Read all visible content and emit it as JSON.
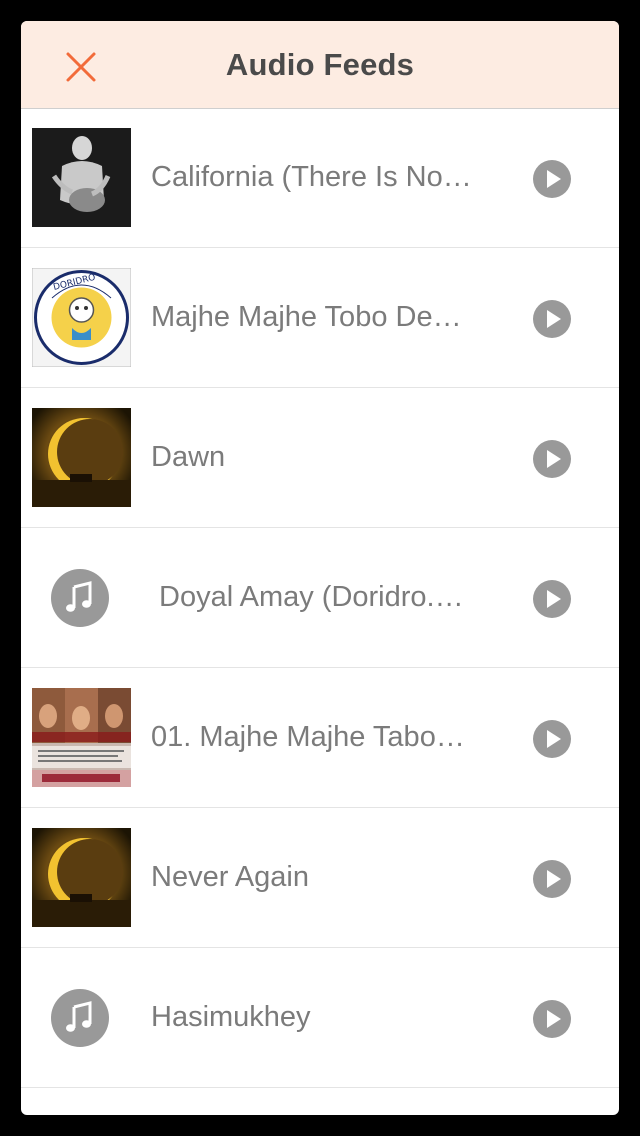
{
  "header": {
    "title": "Audio Feeds",
    "close_icon": "close-icon"
  },
  "colors": {
    "header_bg": "#fdece2",
    "close_accent": "#f26b3a",
    "text_gray": "#7b7b7b",
    "icon_gray": "#999999",
    "title_text": "#4a4a4a"
  },
  "feeds": [
    {
      "title": "California (There Is No…",
      "artwork": "album-cover-dark-figure"
    },
    {
      "title": "Majhe Majhe Tobo De…",
      "artwork": "doridro-logo"
    },
    {
      "title": "Dawn",
      "artwork": "album-cover-eclipse"
    },
    {
      "title": "Doyal Amay (Doridro.…",
      "artwork": "music-note-icon"
    },
    {
      "title": "01. Majhe Majhe Tabo…",
      "artwork": "album-cover-faces"
    },
    {
      "title": "Never Again",
      "artwork": "album-cover-eclipse"
    },
    {
      "title": "Hasimukhey",
      "artwork": "music-note-icon"
    }
  ]
}
